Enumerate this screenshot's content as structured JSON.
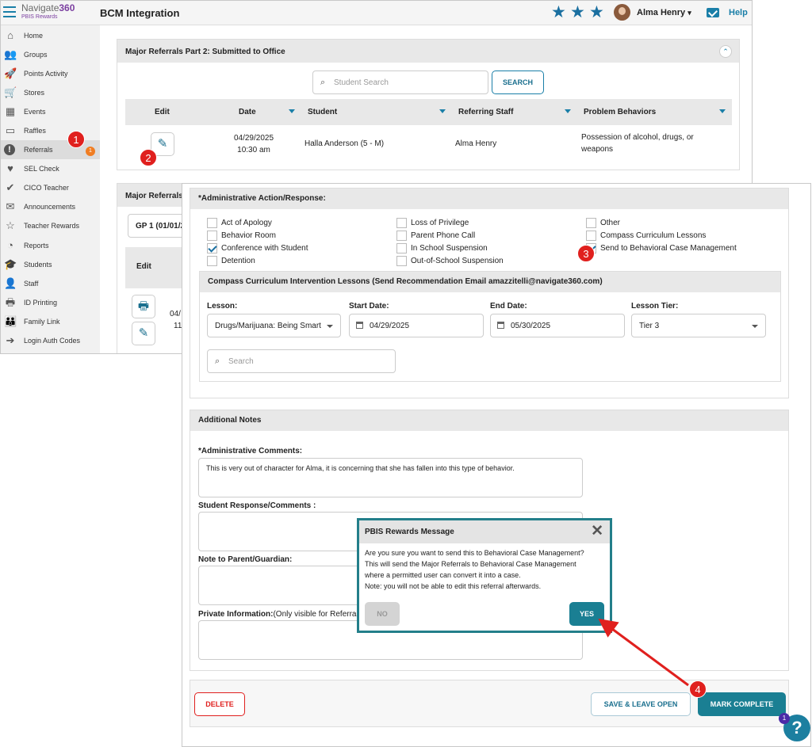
{
  "app": {
    "logo_main": "Navigate",
    "logo_num": "360",
    "logo_sub": "PBIS Rewards",
    "title": "BCM Integration",
    "user_name": "Alma Henry",
    "user_caret": "▾",
    "help": "Help",
    "stars": [
      "★",
      "★",
      "★"
    ]
  },
  "sidebar": {
    "items": [
      {
        "label": "Home",
        "icon": "⌂"
      },
      {
        "label": "Groups",
        "icon": "👥"
      },
      {
        "label": "Points Activity",
        "icon": "🚀"
      },
      {
        "label": "Stores",
        "icon": "🛒"
      },
      {
        "label": "Events",
        "icon": "▦"
      },
      {
        "label": "Raffles",
        "icon": "▭"
      },
      {
        "label": "Referrals",
        "icon": "!"
      },
      {
        "label": "SEL Check",
        "icon": "♥"
      },
      {
        "label": "CICO Teacher",
        "icon": "✔"
      },
      {
        "label": "Announcements",
        "icon": "✉"
      },
      {
        "label": "Teacher Rewards",
        "icon": "☆"
      },
      {
        "label": "Reports",
        "icon": "◔"
      },
      {
        "label": "Students",
        "icon": "🎓"
      },
      {
        "label": "Staff",
        "icon": "👤"
      },
      {
        "label": "ID Printing",
        "icon": "🖶"
      },
      {
        "label": "Family Link",
        "icon": "👪"
      },
      {
        "label": "Login Auth Codes",
        "icon": "➔"
      }
    ],
    "referrals_badge": "1"
  },
  "panel1": {
    "title": "Major Referrals Part 2: Submitted to Office",
    "collapse": "⌃",
    "search_placeholder": "Student Search",
    "search_button": "SEARCH",
    "columns": [
      "Edit",
      "Date",
      "Student",
      "Referring Staff",
      "Problem Behaviors"
    ],
    "row": {
      "date": "04/29/2025",
      "time": "10:30 am",
      "student": "Halla Anderson (5 - M)",
      "staff": "Alma Henry",
      "behavior": "Possession of alcohol, drugs, or weapons"
    }
  },
  "panel2": {
    "title": "Major Referrals",
    "filter": "GP 1 (01/01/2",
    "edit_header": "Edit",
    "row_date": "04/",
    "row_time": "11"
  },
  "steps": [
    "1",
    "2",
    "3",
    "4"
  ],
  "admin": {
    "title": "*Administrative Action/Response:",
    "options": [
      {
        "label": "Act of Apology",
        "checked": false
      },
      {
        "label": "Behavior Room",
        "checked": false
      },
      {
        "label": "Conference with Student",
        "checked": true
      },
      {
        "label": "Detention",
        "checked": false
      },
      {
        "label": "Loss of Privilege",
        "checked": false
      },
      {
        "label": "Parent Phone Call",
        "checked": false
      },
      {
        "label": "In School Suspension",
        "checked": false
      },
      {
        "label": "Out-of-School Suspension",
        "checked": false
      },
      {
        "label": "Other",
        "checked": false
      },
      {
        "label": "Compass Curriculum Lessons",
        "checked": false
      },
      {
        "label": "Send to Behavioral Case Management",
        "checked": true
      }
    ]
  },
  "compass": {
    "title": "Compass Curriculum Intervention Lessons (Send Recommendation Email amazzitelli@navigate360.com)",
    "lesson_label": "Lesson:",
    "lesson_value": "Drugs/Marijuana: Being Smart",
    "start_label": "Start Date:",
    "start_value": "04/29/2025",
    "end_label": "End Date:",
    "end_value": "05/30/2025",
    "tier_label": "Lesson Tier:",
    "tier_value": "Tier 3",
    "search_placeholder": "Search"
  },
  "notes": {
    "title": "Additional Notes",
    "admin_comments_label": "*Administrative Comments:",
    "admin_comments_value": "This is very out of character for Alma, it is concerning that she has fallen into this type of behavior.",
    "student_response_label": "Student Response/Comments :",
    "parent_note_label": "Note to Parent/Guardian:",
    "private_label_bold": "Private Information:",
    "private_label_rest": "(Only visible for Referra"
  },
  "footer": {
    "delete": "DELETE",
    "save_leave": "SAVE & LEAVE OPEN",
    "mark_complete": "MARK COMPLETE"
  },
  "modal": {
    "title": "PBIS Rewards Message",
    "close": "✕",
    "lines": [
      "Are you sure you want to send this to Behavioral Case Management?",
      "This will send the Major Referrals to Behavioral Case Management",
      "where a permitted user can convert it into a case.",
      "Note: you will not be able to edit this referral afterwards."
    ],
    "no": "NO",
    "yes": "YES"
  },
  "help_widget": {
    "badge": "1",
    "glyph": "?"
  },
  "colors": {
    "teal": "#1a7fa8",
    "annotation_red": "#e0201e",
    "modal_border": "#237f8a"
  }
}
